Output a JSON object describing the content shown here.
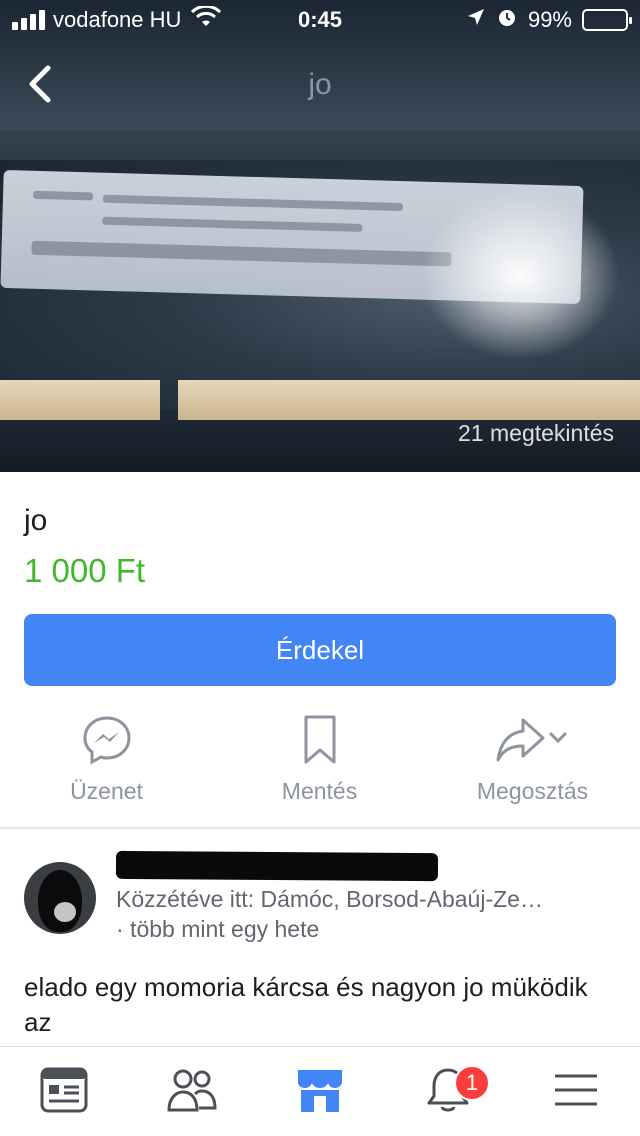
{
  "status_bar": {
    "carrier": "vodafone HU",
    "time": "0:45",
    "battery": "99%"
  },
  "nav": {
    "title": "jo"
  },
  "hero": {
    "views": "21 megtekintés"
  },
  "listing": {
    "title": "jo",
    "price": "1 000 Ft",
    "cta_label": "Érdekel"
  },
  "actions": {
    "message": "Üzenet",
    "save": "Mentés",
    "share": "Megosztás"
  },
  "seller": {
    "posted_in": "Közzétéve itt: Dámóc, Borsod-Abaúj-Ze…",
    "posted_when": "· több mint egy hete"
  },
  "description": "elado egy momoria kárcsa és nagyon jo müködik az",
  "tabbar": {
    "notifications_badge": "1"
  },
  "colors": {
    "accent": "#4285f4",
    "price": "#42b72a",
    "badge": "#fa3e3e"
  },
  "icons": [
    "back-chevron-icon",
    "messenger-icon",
    "bookmark-icon",
    "share-icon",
    "news-feed-icon",
    "friends-icon",
    "marketplace-icon",
    "notifications-bell-icon",
    "menu-icon"
  ]
}
